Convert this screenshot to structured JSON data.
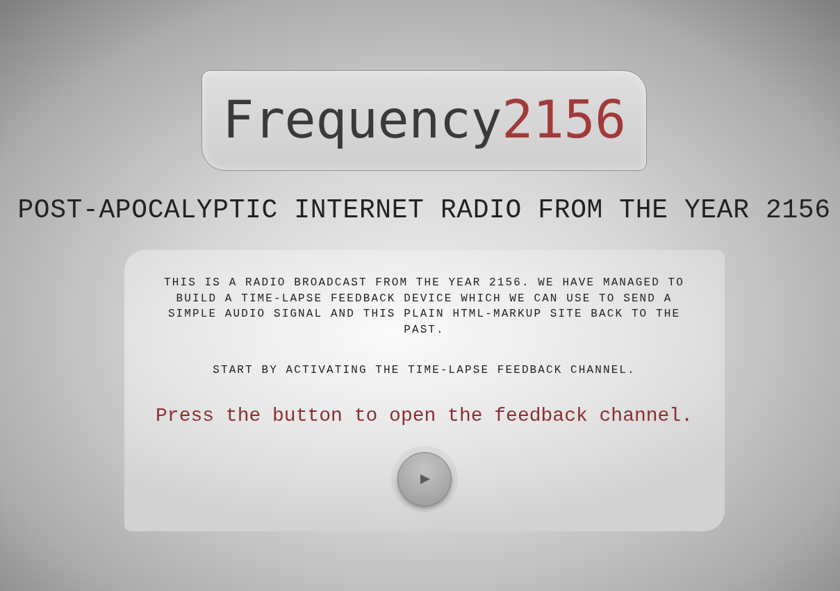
{
  "logo": {
    "name": "Frequency",
    "number": "2156"
  },
  "tagline": "POST-APOCALYPTIC INTERNET RADIO FROM THE YEAR 2156",
  "intro": {
    "paragraphs": [
      "THIS IS A RADIO BROADCAST FROM THE YEAR 2156. WE HAVE MANAGED TO BUILD A TIME-LAPSE FEEDBACK DEVICE WHICH WE CAN USE TO SEND A SIMPLE AUDIO SIGNAL AND THIS PLAIN HTML-MARKUP SITE BACK TO THE PAST.",
      "START BY ACTIVATING THE TIME-LAPSE FEEDBACK CHANNEL."
    ],
    "prompt": "Press the button to open the feedback channel."
  }
}
